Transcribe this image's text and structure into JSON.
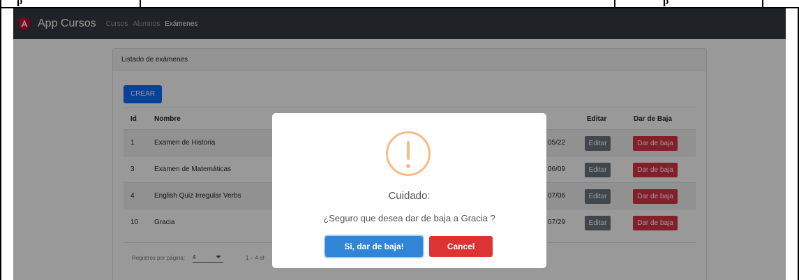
{
  "doc_strip": {
    "left_text": "p",
    "right_text": "p"
  },
  "navbar": {
    "brand": "App Cursos",
    "links": [
      "Cursos",
      "Alumnos",
      "Exámenes"
    ]
  },
  "card": {
    "header": "Listado de exámenes",
    "create_label": "CREAR"
  },
  "table": {
    "columns": {
      "id": "Id",
      "nombre": "Nombre",
      "editar": "Editar",
      "baja": "Dar de Baja"
    },
    "rows": [
      {
        "id": "1",
        "nombre": "Examen de Historia",
        "fecha_frag": "05/22",
        "edit_label": "Editar",
        "baja_label": "Dar de baja"
      },
      {
        "id": "3",
        "nombre": "Examen de Matemáticas",
        "fecha_frag": "06/09",
        "edit_label": "Editar",
        "baja_label": "Dar de baja"
      },
      {
        "id": "4",
        "nombre": "English Quiz Irregular Verbs",
        "fecha_frag": "07/06",
        "edit_label": "Editar",
        "baja_label": "Dar de baja"
      },
      {
        "id": "10",
        "nombre": "Gracia",
        "fecha_frag": "07/29",
        "edit_label": "Editar",
        "baja_label": "Dar de baja"
      }
    ]
  },
  "paginator": {
    "label": "Registros por página:",
    "page_size": "4",
    "range": "1 – 4 of"
  },
  "modal": {
    "title": "Cuidado:",
    "text": "¿Seguro que desea dar de baja a Gracia ?",
    "confirm_label": "Si, dar de baja!",
    "cancel_label": "Cancel"
  },
  "colors": {
    "navbar": "#343a40",
    "primary": "#0d6efd",
    "danger": "#dc3545",
    "secondary": "#6c757d",
    "warning_icon": "#f8bb86",
    "confirm": "#3085d6",
    "cancel": "#dd3333"
  },
  "icons": {
    "logo": "angular-logo-icon",
    "modal": "warning-icon"
  }
}
